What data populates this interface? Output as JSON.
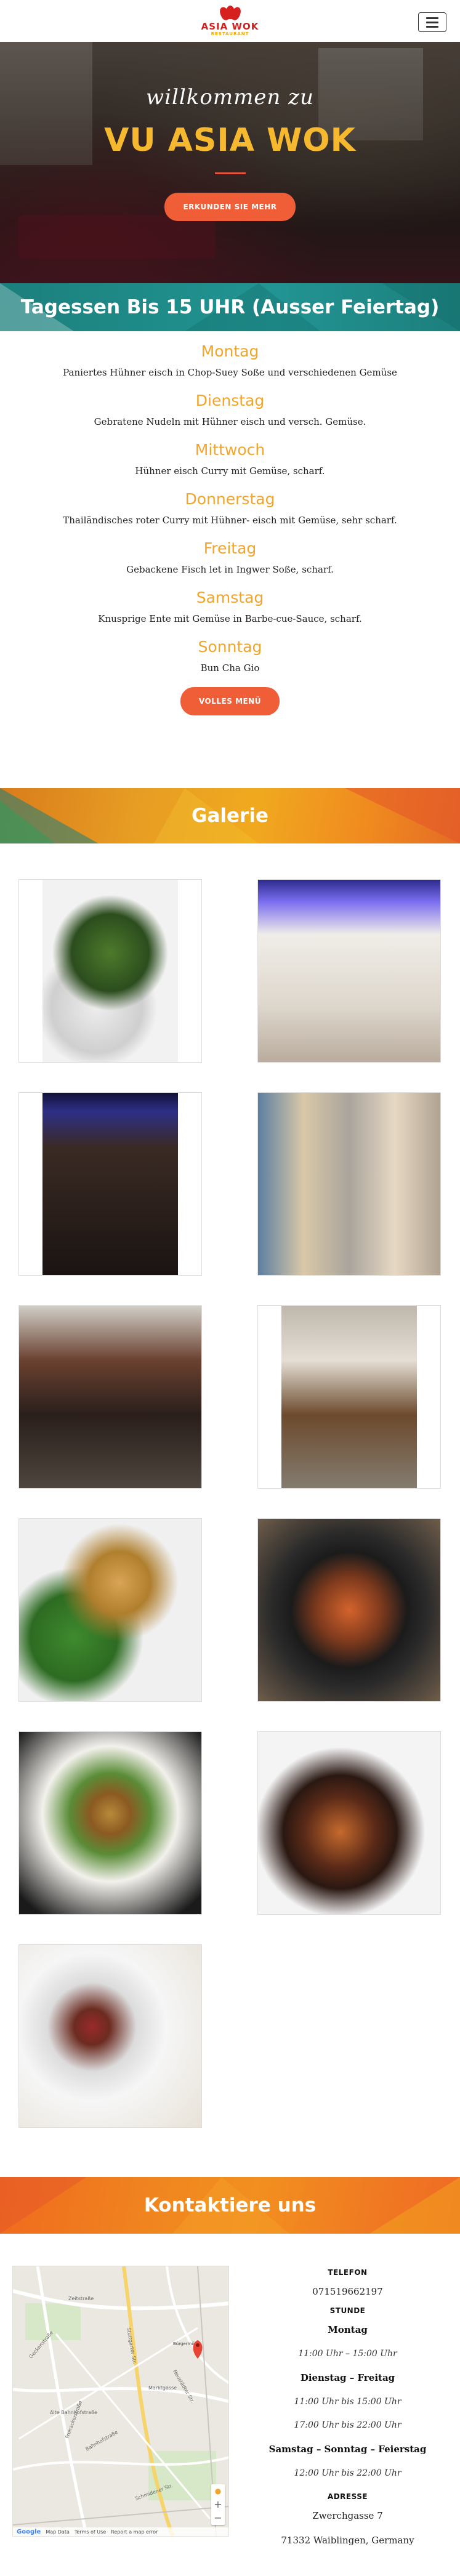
{
  "header": {
    "logo_text": "ASIA WOK",
    "logo_sub": "RESTAURANT",
    "menu_toggle_label": "Toggle navigation"
  },
  "hero": {
    "welcome": "willkommen zu",
    "title": "VU ASIA WOK",
    "cta_label": "ERKUNDEN SIE MEHR"
  },
  "tagessen": {
    "title": "Tagessen Bis 15 UHR (Ausser Feiertag)",
    "days": [
      {
        "name": "Montag",
        "dish": "Paniertes Hühner eisch in Chop-Suey Soße und verschiedenen Gemüse"
      },
      {
        "name": "Dienstag",
        "dish": "Gebratene Nudeln mit Hühner eisch und versch. Gemüse."
      },
      {
        "name": "Mittwoch",
        "dish": "Hühner eisch Curry mit Gemüse, scharf."
      },
      {
        "name": "Donnerstag",
        "dish": "Thailändisches roter Curry mit Hühner- eisch mit Gemüse, sehr scharf."
      },
      {
        "name": "Freitag",
        "dish": "Gebackene Fisch let in Ingwer Soße, scharf."
      },
      {
        "name": "Samstag",
        "dish": "Knusprige Ente mit Gemüse in Barbe-cue-Sauce, scharf."
      },
      {
        "name": "Sonntag",
        "dish": "Bun Cha Gio"
      }
    ],
    "cta_label": "VOLLES MENÜ"
  },
  "gallery": {
    "title": "Galerie"
  },
  "contact": {
    "title": "Kontaktiere uns",
    "telefon_label": "TELEFON",
    "telefon_value": "071519662197",
    "stunde_label": "STUNDE",
    "groups": [
      {
        "day": "Montag",
        "hours": [
          "11:00 Uhr – 15:00 Uhr"
        ]
      },
      {
        "day": "Dienstag – Freitag",
        "hours": [
          "11:00 Uhr bis 15:00 Uhr",
          "17:00 Uhr bis 22:00 Uhr"
        ]
      },
      {
        "day": "Samstag – Sonntag – Feierstag",
        "hours": [
          "12:00 Uhr bis 22:00 Uhr"
        ]
      }
    ],
    "adresse_label": "ADRESSE",
    "address_line1": "Zwerchgasse 7",
    "address_line2": "71332 Waiblingen, Germany"
  },
  "map": {
    "streets": [
      "Zeitstraße",
      "Geckenstraße",
      "Stuttgarter Str.",
      "Alte Bahnhofstraße",
      "Bahnhofstraße",
      "Fronackerstraße",
      "Marktgasse",
      "Neustädter Str.",
      "Schmidener Str."
    ],
    "marker_label": "Bürgermühle",
    "footer_google": "Google",
    "footer_items": [
      "Map Data",
      "Terms of Use",
      "Report a map error"
    ]
  },
  "colors": {
    "accent_orange": "#ef5e37",
    "day_name": "#f2a52a",
    "teal_band": "#1f8e8b",
    "orange_band": "#f0a91f",
    "hero_title": "#f5b82e"
  }
}
